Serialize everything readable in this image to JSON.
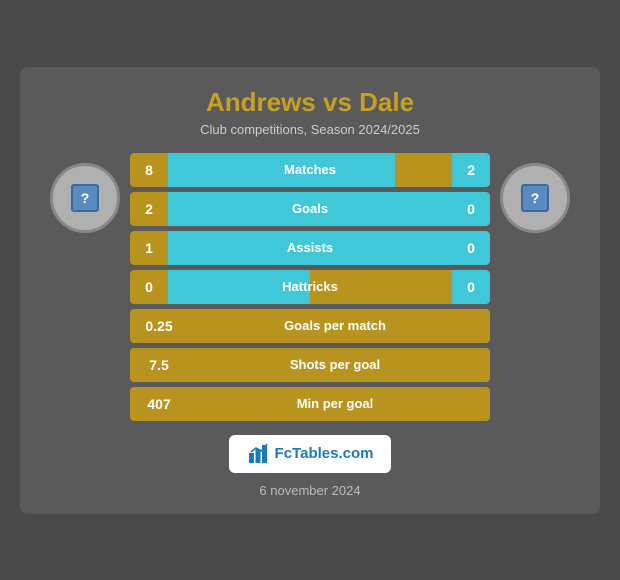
{
  "header": {
    "title": "Andrews vs Dale",
    "subtitle": "Club competitions, Season 2024/2025"
  },
  "stats": [
    {
      "label": "Matches",
      "left": "8",
      "right": "2",
      "fill_pct": 80,
      "type": "two-sided"
    },
    {
      "label": "Goals",
      "left": "2",
      "right": "0",
      "fill_pct": 100,
      "type": "two-sided"
    },
    {
      "label": "Assists",
      "left": "1",
      "right": "0",
      "fill_pct": 100,
      "type": "two-sided"
    },
    {
      "label": "Hattricks",
      "left": "0",
      "right": "0",
      "fill_pct": 50,
      "type": "two-sided"
    },
    {
      "label": "Goals per match",
      "left": "0.25",
      "type": "single"
    },
    {
      "label": "Shots per goal",
      "left": "7.5",
      "type": "single"
    },
    {
      "label": "Min per goal",
      "left": "407",
      "type": "single"
    }
  ],
  "branding": {
    "text_fc": "Fc",
    "text_tables": "Tables.com"
  },
  "date": "6 november 2024"
}
